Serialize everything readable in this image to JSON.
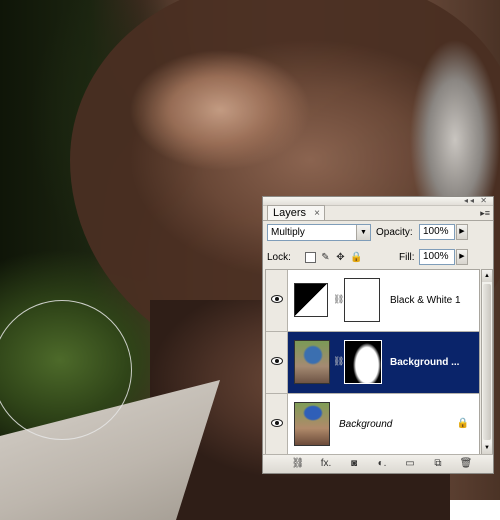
{
  "canvas": {
    "description_icon": "photo-canvas"
  },
  "panel": {
    "tab_label": "Layers",
    "tab_close": "×",
    "menu_icon": "▸≡",
    "top_buttons": "◂◂ ✕",
    "blend_mode": "Multiply",
    "opacity_label": "Opacity:",
    "opacity_value": "100%",
    "lock_label": "Lock:",
    "fill_label": "Fill:",
    "fill_value": "100%",
    "layers": [
      {
        "name": "Black & White 1",
        "visible": true,
        "selected": false,
        "type": "adjustment"
      },
      {
        "name": "Background ...",
        "visible": true,
        "selected": true,
        "type": "masked-image"
      },
      {
        "name": "Background",
        "visible": true,
        "selected": false,
        "type": "locked-image"
      }
    ],
    "bottom_icons": [
      "link-icon",
      "fx-icon",
      "mask-icon",
      "adjustment-icon",
      "group-icon",
      "new-layer-icon",
      "trash-icon"
    ],
    "bottom_labels": [
      "⛓",
      "fx.",
      "◙",
      "◐.",
      "▭",
      "⧉",
      "🗑"
    ]
  }
}
